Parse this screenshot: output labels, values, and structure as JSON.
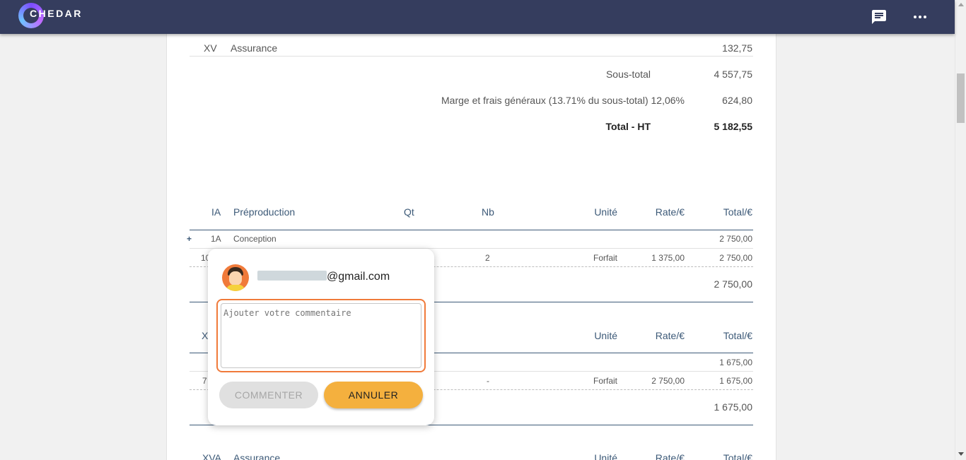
{
  "app": {
    "logo_text": "CHEDAR",
    "logo_first": "C",
    "logo_rest": "HEDAR"
  },
  "section_top": {
    "row": {
      "code": "XV",
      "label": "Assurance",
      "total": "132,75"
    },
    "subtotal_label": "Sous-total",
    "subtotal_value": "4 557,75",
    "marge_label": "Marge et frais généraux (13.71% du sous-total) 12,06%",
    "marge_value": "624,80",
    "total_label": "Total - HT",
    "total_value": "5 182,55"
  },
  "section_ia": {
    "headers": {
      "code": "IA",
      "label": "Préproduction",
      "qt": "Qt",
      "nb": "Nb",
      "unite": "Unité",
      "rate": "Rate/€",
      "total": "Total/€"
    },
    "expand_symbol": "+",
    "group": {
      "code": "1A",
      "label": "Conception",
      "total": "2 750,00"
    },
    "item": {
      "code_partial": "10",
      "nb": "2",
      "unite": "Forfait",
      "rate": "1 375,00",
      "total": "2 750,00"
    },
    "section_total": "2 750,00"
  },
  "section_x": {
    "headers": {
      "code_partial": "X",
      "unite": "Unité",
      "rate": "Rate/€",
      "total": "Total/€"
    },
    "group_total": "1 675,00",
    "item": {
      "code_partial": "7",
      "nb": "-",
      "unite": "Forfait",
      "rate": "2 750,00",
      "total": "1 675,00"
    },
    "section_total": "1 675,00"
  },
  "section_xva": {
    "headers": {
      "code": "XVA",
      "label": "Assurance",
      "unite": "Unité",
      "rate": "Rate/€",
      "total": "Total/€"
    }
  },
  "comment_popup": {
    "email_suffix": "@gmail.com",
    "placeholder": "Ajouter votre commentaire",
    "comment_button": "COMMENTER",
    "cancel_button": "ANNULER"
  },
  "colors": {
    "topbar": "#353d5e",
    "accent": "#f4b03e",
    "focus_outline": "#f07a3a",
    "header_text": "#3d5a78"
  }
}
